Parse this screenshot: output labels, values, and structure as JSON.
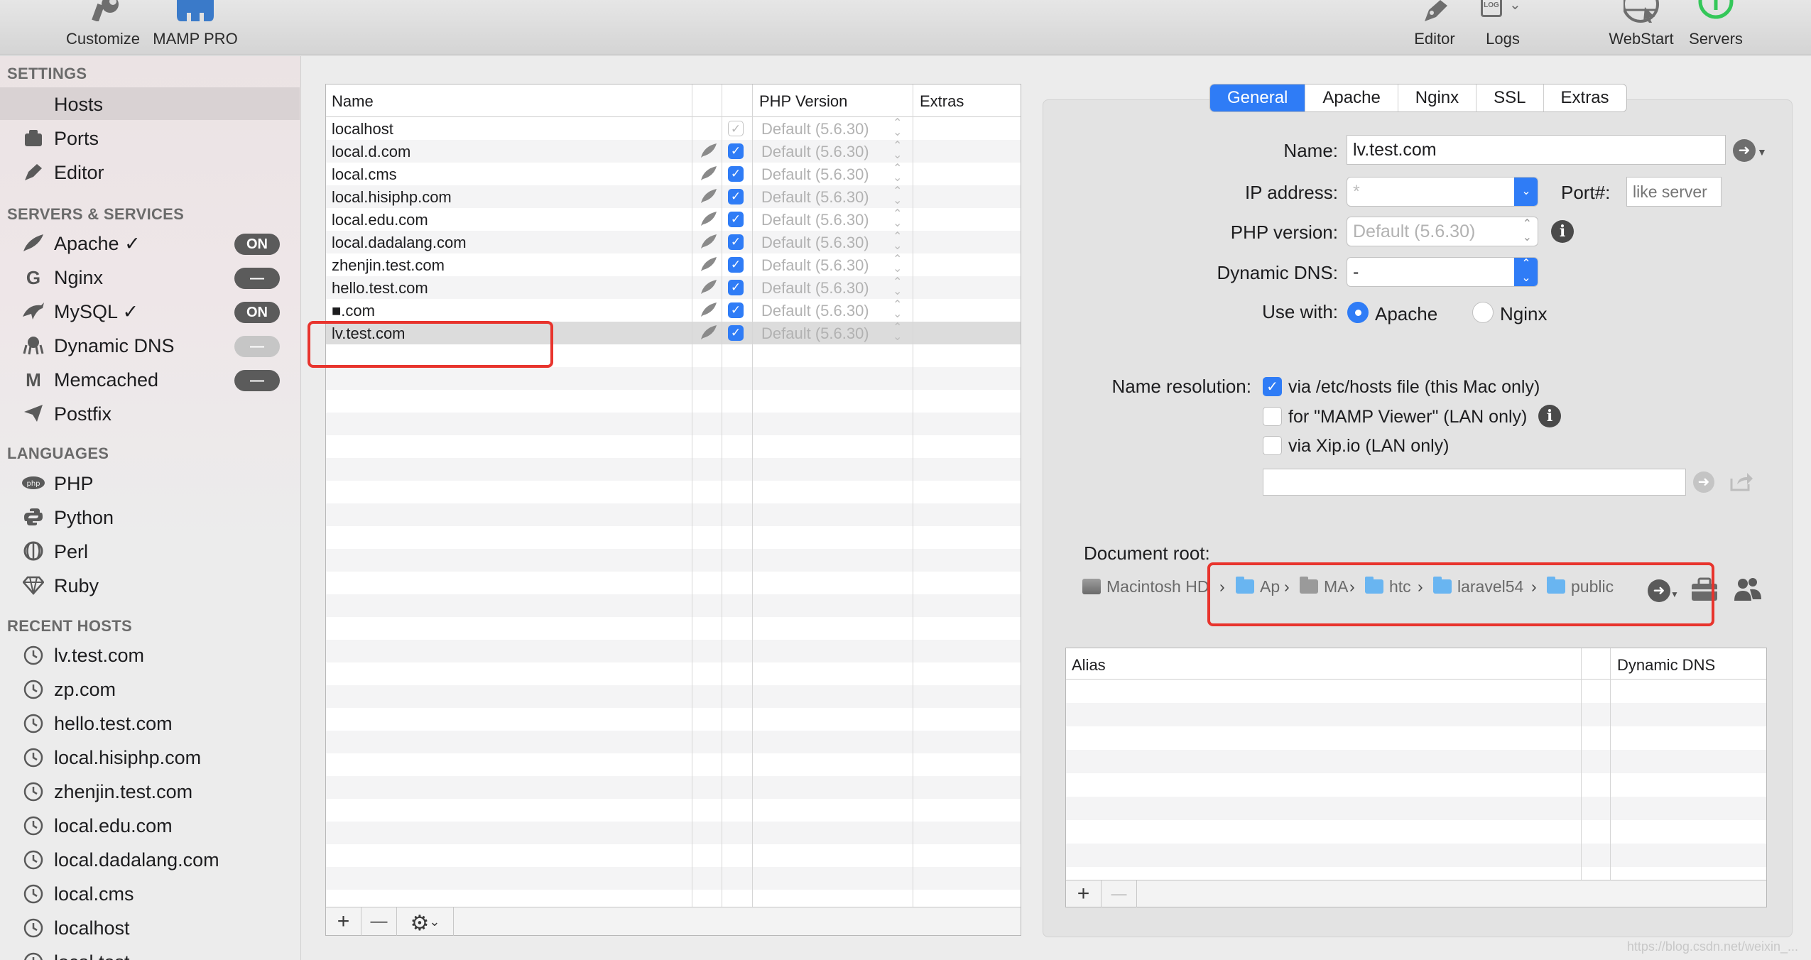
{
  "toolbar": {
    "customize_label": "Customize",
    "mamp_label": "MAMP PRO",
    "editor_label": "Editor",
    "logs_label": "Logs",
    "webstart_label": "WebStart",
    "servers_label": "Servers",
    "logs_badge": "LOG",
    "icons": [
      "wrench-icon",
      "elephant-icon",
      "pen-icon",
      "log-icon",
      "globe-icon",
      "power-icon"
    ]
  },
  "sidebar": {
    "settings_heading": "SETTINGS",
    "settings_items": [
      {
        "label": "Hosts",
        "icon": "none",
        "selected": true
      },
      {
        "label": "Ports",
        "icon": "ports-icon"
      },
      {
        "label": "Editor",
        "icon": "pen-icon"
      }
    ],
    "servers_heading": "SERVERS & SERVICES",
    "servers_items": [
      {
        "label": "Apache ✓",
        "icon": "feather-icon",
        "status": "ON"
      },
      {
        "label": "Nginx",
        "icon": "nginx-icon",
        "status": "—"
      },
      {
        "label": "MySQL ✓",
        "icon": "dolphin-icon",
        "status": "ON"
      },
      {
        "label": "Dynamic DNS",
        "icon": "octopus-icon",
        "status": "—"
      },
      {
        "label": "Memcached",
        "icon": "memcached-icon",
        "status": "—"
      },
      {
        "label": "Postfix",
        "icon": "paper-plane-icon",
        "status": ""
      }
    ],
    "languages_heading": "LANGUAGES",
    "languages_items": [
      {
        "label": "PHP",
        "icon": "php-icon"
      },
      {
        "label": "Python",
        "icon": "python-icon"
      },
      {
        "label": "Perl",
        "icon": "camel-icon"
      },
      {
        "label": "Ruby",
        "icon": "gem-icon"
      }
    ],
    "recent_heading": "RECENT HOSTS",
    "recent_items": [
      "lv.test.com",
      "zp.com",
      "hello.test.com",
      "local.hisiphp.com",
      "zhenjin.test.com",
      "local.edu.com",
      "local.dadalang.com",
      "local.cms",
      "localhost",
      "local.test"
    ],
    "status_colors": {
      "on": "#5b5b5b",
      "off_dim": "#c6c6c6"
    }
  },
  "hosts_table": {
    "columns": [
      "Name",
      "",
      "",
      "PHP Version",
      "Extras"
    ],
    "rows": [
      {
        "name": "localhost",
        "leaf": false,
        "checked": true,
        "dim": true,
        "php": "Default (5.6.30)"
      },
      {
        "name": "local.d.com",
        "leaf": true,
        "checked": true,
        "dim": false,
        "php": "Default (5.6.30)"
      },
      {
        "name": "local.cms",
        "leaf": true,
        "checked": true,
        "dim": false,
        "php": "Default (5.6.30)"
      },
      {
        "name": "local.hisiphp.com",
        "leaf": true,
        "checked": true,
        "dim": false,
        "php": "Default (5.6.30)"
      },
      {
        "name": "local.edu.com",
        "leaf": true,
        "checked": true,
        "dim": false,
        "php": "Default (5.6.30)"
      },
      {
        "name": "local.dadalang.com",
        "leaf": true,
        "checked": true,
        "dim": false,
        "php": "Default (5.6.30)"
      },
      {
        "name": "zhenjin.test.com",
        "leaf": true,
        "checked": true,
        "dim": false,
        "php": "Default (5.6.30)"
      },
      {
        "name": "hello.test.com",
        "leaf": true,
        "checked": true,
        "dim": false,
        "php": "Default (5.6.30)"
      },
      {
        "name": "■.com",
        "leaf": true,
        "checked": true,
        "dim": false,
        "php": "Default (5.6.30)"
      },
      {
        "name": "lv.test.com",
        "leaf": true,
        "checked": true,
        "dim": false,
        "php": "Default (5.6.30)",
        "selected": true
      }
    ],
    "footer": {
      "add": "+",
      "remove": "—",
      "gear": "⚙",
      "gear_menu": "⌄"
    }
  },
  "detail": {
    "tabs": [
      {
        "label": "General",
        "active": true
      },
      {
        "label": "Apache"
      },
      {
        "label": "Nginx"
      },
      {
        "label": "SSL"
      },
      {
        "label": "Extras"
      }
    ],
    "name_label": "Name:",
    "name_value": "lv.test.com",
    "ip_label": "IP address:",
    "ip_value": "*",
    "port_label": "Port#:",
    "port_placeholder": "like server",
    "php_label": "PHP version:",
    "php_value": "Default (5.6.30)",
    "ddns_label": "Dynamic DNS:",
    "ddns_value": "-",
    "use_with_label": "Use with:",
    "use_with_apache": "Apache",
    "use_with_nginx": "Nginx",
    "use_with_selected": "Apache",
    "name_resolution_label": "Name resolution:",
    "resolution_options": [
      {
        "label": "via /etc/hosts file (this Mac only)",
        "checked": true
      },
      {
        "label": "for \"MAMP Viewer\" (LAN only)",
        "checked": false
      },
      {
        "label": "via Xip.io (LAN only)",
        "checked": false
      }
    ],
    "xip_value": "",
    "docroot_label": "Document root:",
    "docroot_path": [
      {
        "label": "Macintosh HD",
        "icon": "disk-icon"
      },
      {
        "label": "Ap",
        "icon": "folder-icon"
      },
      {
        "label": "MA",
        "icon": "folder-gray-icon"
      },
      {
        "label": "htc",
        "icon": "folder-icon"
      },
      {
        "label": "laravel54",
        "icon": "folder-icon"
      },
      {
        "label": "public",
        "icon": "folder-icon"
      }
    ],
    "alias_columns": [
      "Alias",
      "",
      "Dynamic DNS"
    ],
    "alias_rows": [],
    "alias_footer": {
      "add": "+",
      "remove": "—"
    },
    "accent_color": "#2f7cf6",
    "annotation_color": "#e8342d"
  },
  "watermark": "https://blog.csdn.net/weixin_..."
}
